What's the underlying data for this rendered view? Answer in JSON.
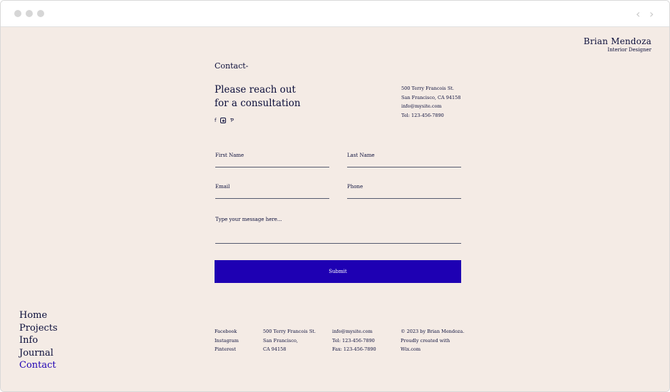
{
  "brand": {
    "name": "Brian Mendoza",
    "tagline": "Interior Designer"
  },
  "contact": {
    "title": "Contact-",
    "headline_line1": "Please reach out",
    "headline_line2": "for a consultation",
    "social_icons": [
      "facebook-icon",
      "instagram-icon",
      "pinterest-icon"
    ],
    "address_line1": "500 Terry Francois St.",
    "address_line2": "San Francisco, CA 94158",
    "email": "info@mysite.com",
    "tel": "Tel: 123-456-7890"
  },
  "form": {
    "first_name_label": "First Name",
    "last_name_label": "Last Name",
    "email_label": "Email",
    "phone_label": "Phone",
    "message_placeholder": "Type your message here...",
    "submit_label": "Submit"
  },
  "nav": {
    "items": [
      "Home",
      "Projects",
      "Info",
      "Journal",
      "Contact"
    ],
    "active": "Contact"
  },
  "footer": {
    "social": [
      "Facebook",
      "Instagram",
      "Pinterest"
    ],
    "address_line1": "500 Terry Francois St.",
    "address_line2": "San Francisco,",
    "address_line3": "CA 94158",
    "email": "info@mysite.com",
    "tel": "Tel: 123-456-7890",
    "fax": "Fax: 123-456-7890",
    "copyright_line1": "© 2023 by Brian Mendoza.",
    "copyright_line2": "Proudly created with",
    "copyright_line3": "Wix.com"
  },
  "colors": {
    "background": "#f4ebe5",
    "text": "#0b0e3a",
    "accent": "#1e00b3"
  }
}
